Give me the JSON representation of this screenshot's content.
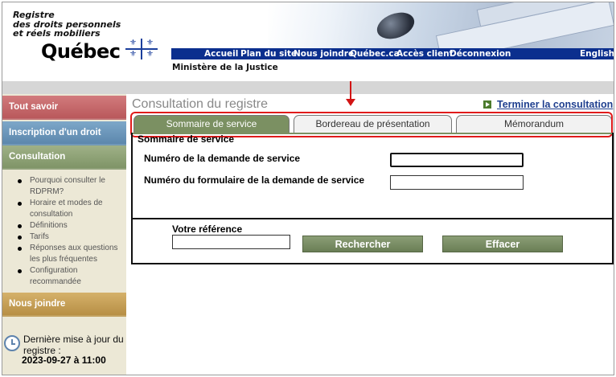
{
  "header": {
    "brand_lines": [
      "Registre",
      "des droits personnels",
      "et réels mobiliers"
    ],
    "brand_name": "Québec",
    "nav": [
      "Accueil",
      "Plan du site",
      "Nous joindre",
      "Québec.ca",
      "Accès client",
      "Déconnexion",
      "English"
    ],
    "ministry": "Ministère de la Justice"
  },
  "sidebar": {
    "tout_savoir": "Tout savoir",
    "inscription": "Inscription d'un droit",
    "consultation": "Consultation",
    "links": [
      "Pourquoi consulter le RDPRM?",
      "Horaire et modes de consultation",
      "Définitions",
      "Tarifs",
      "Réponses aux questions les plus fréquentes",
      "Configuration recommandée"
    ],
    "nous_joindre": "Nous joindre",
    "update_label": "Dernière mise à jour du registre :",
    "update_date": "2023-09-27 à 11:00"
  },
  "main": {
    "title": "Consultation du registre",
    "end_link": "Terminer la consultation",
    "tabs": [
      "Sommaire de service",
      "Bordereau de présentation",
      "Mémorandum"
    ],
    "panel_title": "Sommaire de service",
    "field_request_label": "Numéro de la demande de service",
    "field_request_value": "",
    "field_form_label": "Numéro du formulaire de la demande de service",
    "field_form_value": "",
    "reference_label": "Votre référence",
    "reference_value": "",
    "search_button": "Rechercher",
    "clear_button": "Effacer"
  }
}
